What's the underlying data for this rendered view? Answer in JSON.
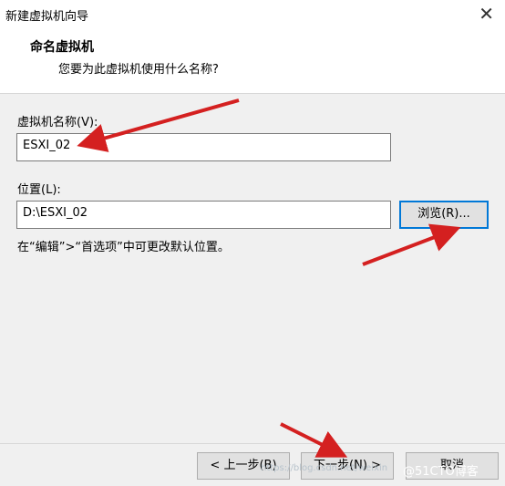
{
  "window": {
    "title": "新建虚拟机向导",
    "close_glyph": "✕"
  },
  "header": {
    "title": "命名虚拟机",
    "subtitle": "您要为此虚拟机使用什么名称?"
  },
  "form": {
    "name_label": "虚拟机名称(V):",
    "name_value": "ESXI_02",
    "location_label": "位置(L):",
    "location_value": "D:\\ESXI_02",
    "browse_label": "浏览(R)...",
    "hint": "在“编辑”>“首选项”中可更改默认位置。"
  },
  "footer": {
    "back_label": "< 上一步(B)",
    "next_label": "下一步(N) >",
    "cancel_label": "取消"
  },
  "watermark": {
    "url_text": "https://blog.csdn.net/weixin",
    "brand_text": "@51CTO博客"
  },
  "annotation": {
    "arrow_color": "#d42020"
  }
}
